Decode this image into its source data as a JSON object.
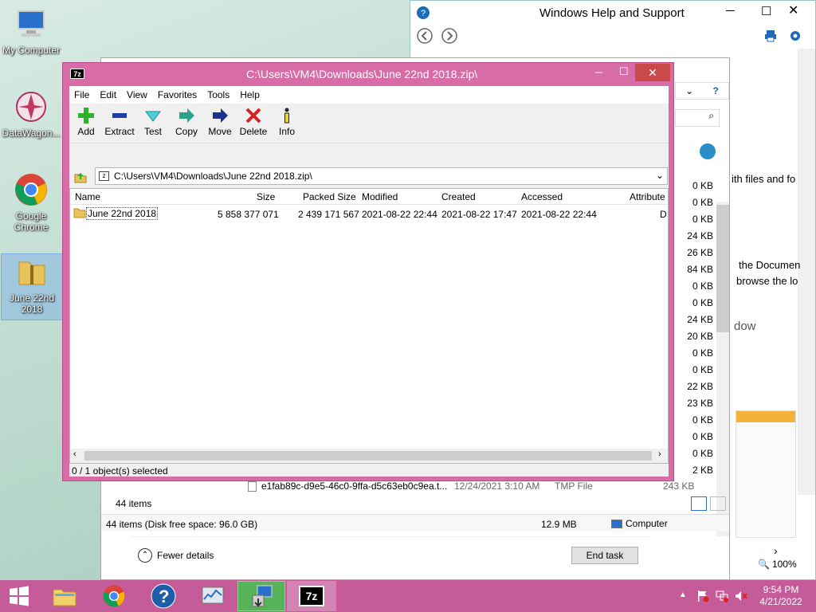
{
  "desktop": {
    "icons": [
      {
        "label": "My Computer"
      },
      {
        "label": "DataWagon..."
      },
      {
        "label": "Google Chrome"
      },
      {
        "label": "June 22nd 2018"
      }
    ]
  },
  "help": {
    "title": "Windows Help and Support",
    "fragments": [
      "ith files and fo",
      "the Documen",
      "browse the lo",
      "dow"
    ]
  },
  "taskmgr": {
    "sizes": [
      "0 KB",
      "0 KB",
      "0 KB",
      "24 KB",
      "26 KB",
      "84 KB",
      "0 KB",
      "0 KB",
      "24 KB",
      "20 KB",
      "0 KB",
      "0 KB",
      "22 KB",
      "23 KB",
      "0 KB",
      "0 KB",
      "0 KB",
      "2 KB",
      "243 KB"
    ],
    "file_row": {
      "name": "e1fab89c-d9e5-46c0-9ffa-d5c63eb0c9ea.t...",
      "date": "12/24/2021 3:10 AM",
      "type": "TMP File",
      "size": "243 KB"
    },
    "items_count": "44 items",
    "status_left": "44 items (Disk free space: 96.0 GB)",
    "status_size": "12.9 MB",
    "status_computer": "Computer",
    "fewer_details": "Fewer details",
    "end_task": "End task",
    "zoom": "100%"
  },
  "sevenzip": {
    "title": "C:\\Users\\VM4\\Downloads\\June 22nd 2018.zip\\",
    "menu": [
      "File",
      "Edit",
      "View",
      "Favorites",
      "Tools",
      "Help"
    ],
    "toolbar": [
      "Add",
      "Extract",
      "Test",
      "Copy",
      "Move",
      "Delete",
      "Info"
    ],
    "address": "C:\\Users\\VM4\\Downloads\\June 22nd 2018.zip\\",
    "columns": [
      "Name",
      "Size",
      "Packed Size",
      "Modified",
      "Created",
      "Accessed",
      "Attribute"
    ],
    "rows": [
      {
        "name": "June 22nd 2018",
        "size": "5 858 377 071",
        "packed": "2 439 171 567",
        "modified": "2021-08-22 22:44",
        "created": "2021-08-22 17:47",
        "accessed": "2021-08-22 22:44",
        "attr": "D"
      }
    ],
    "status": "0 / 1 object(s) selected",
    "icon_text": "7z"
  },
  "taskbar": {
    "time": "9:54 PM",
    "date": "4/21/2022",
    "sevenzip_label": "7z"
  },
  "colors": {
    "accent": "#d86ca6",
    "taskbar": "#c65b9a"
  }
}
